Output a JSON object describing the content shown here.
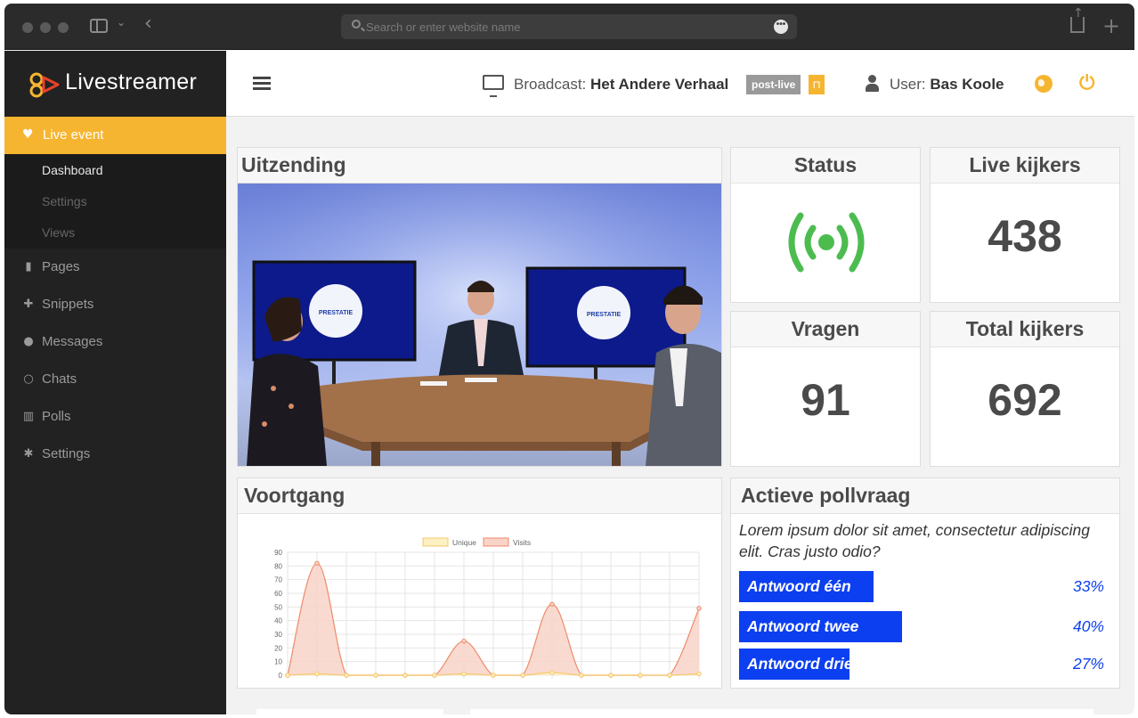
{
  "browser": {
    "url_placeholder": "Search or enter website name",
    "more_glyph": "•••"
  },
  "brand": {
    "name": "Livestreamer"
  },
  "nav": {
    "active": {
      "label": "Live event",
      "icon": "heartbeat-icon"
    },
    "sub": [
      {
        "label": "Dashboard",
        "current": true
      },
      {
        "label": "Settings",
        "current": false
      },
      {
        "label": "Views",
        "current": false
      }
    ],
    "items": [
      {
        "label": "Pages",
        "icon": "file-icon",
        "glyph": "▮"
      },
      {
        "label": "Snippets",
        "icon": "puzzle-icon",
        "glyph": "✚"
      },
      {
        "label": "Messages",
        "icon": "comments-icon",
        "glyph": "●"
      },
      {
        "label": "Chats",
        "icon": "chat-icon",
        "glyph": "○"
      },
      {
        "label": "Polls",
        "icon": "bar-chart-icon",
        "glyph": "▥"
      },
      {
        "label": "Settings",
        "icon": "gear-icon",
        "glyph": "✱"
      }
    ]
  },
  "header": {
    "broadcast_label": "Broadcast:",
    "broadcast_name": "Het Andere Verhaal",
    "status_badge": "post-live",
    "user_label": "User:",
    "user_name": "Bas Koole"
  },
  "panels": {
    "uitzending": {
      "title": "Uitzending"
    },
    "status": {
      "title": "Status"
    },
    "live_kijkers": {
      "title": "Live kijkers",
      "value": "438"
    },
    "vragen": {
      "title": "Vragen",
      "value": "91"
    },
    "total_kijkers": {
      "title": "Total kijkers",
      "value": "692"
    },
    "voortgang": {
      "title": "Voortgang"
    },
    "poll": {
      "title": "Actieve pollvraag",
      "question": "Lorem ipsum dolor sit amet, consectetur adipiscing elit. Cras justo odio?",
      "answers": [
        {
          "label": "Antwoord één",
          "pct": "33%",
          "fraction": 0.33
        },
        {
          "label": "Antwoord  twee",
          "pct": "40%",
          "fraction": 0.4
        },
        {
          "label": "Antwoord drie",
          "pct": "27%",
          "fraction": 0.27
        }
      ]
    }
  },
  "video": {
    "screen_text": "PRESTATIE"
  },
  "colors": {
    "accent": "#f6b530",
    "status_green": "#4cbc4f",
    "poll_blue": "#0c3ff0",
    "unique_fill": "#fdf0c2",
    "unique_line": "#f5c86a",
    "visits_fill": "#f8d3c8",
    "visits_line": "#ee8a6a"
  },
  "chart_data": {
    "type": "area",
    "title": "",
    "xlabel": "",
    "ylabel": "",
    "ylim": [
      0,
      90
    ],
    "yticks": [
      0,
      10,
      20,
      30,
      40,
      50,
      60,
      70,
      80,
      90
    ],
    "x": [
      0,
      1,
      2,
      3,
      4,
      5,
      6,
      7,
      8,
      9,
      10,
      11,
      12,
      13,
      14
    ],
    "legend_position": "top",
    "grid": true,
    "series": [
      {
        "name": "Unique",
        "values": [
          0,
          1,
          0,
          0,
          0,
          0,
          1,
          0,
          0,
          2,
          0,
          0,
          0,
          0,
          1
        ]
      },
      {
        "name": "Visits",
        "values": [
          0,
          82,
          0,
          0,
          0,
          0,
          25,
          0,
          0,
          52,
          0,
          0,
          0,
          0,
          49
        ]
      }
    ]
  }
}
